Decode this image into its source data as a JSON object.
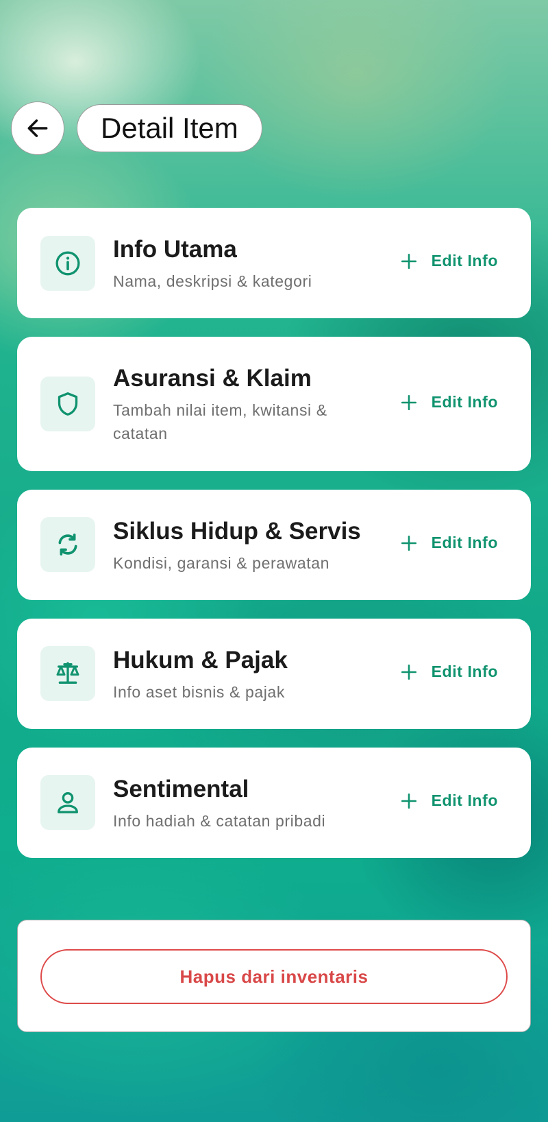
{
  "header": {
    "title": "Detail Item",
    "back_icon": "arrow-left-icon"
  },
  "accent_color": "#10936f",
  "danger_color": "#d94848",
  "sections": [
    {
      "icon": "info-icon",
      "title": "Info Utama",
      "subtitle": "Nama, deskripsi & kategori",
      "action_label": "Edit Info"
    },
    {
      "icon": "shield-icon",
      "title": "Asuransi & Klaim",
      "subtitle": "Tambah nilai item, kwitansi & catatan",
      "action_label": "Edit Info"
    },
    {
      "icon": "refresh-icon",
      "title": "Siklus Hidup & Servis",
      "subtitle": "Kondisi, garansi & perawatan",
      "action_label": "Edit Info"
    },
    {
      "icon": "scale-icon",
      "title": "Hukum & Pajak",
      "subtitle": "Info aset bisnis & pajak",
      "action_label": "Edit Info"
    },
    {
      "icon": "person-icon",
      "title": "Sentimental",
      "subtitle": "Info hadiah & catatan pribadi",
      "action_label": "Edit Info"
    }
  ],
  "danger_zone": {
    "delete_label": "Hapus dari inventaris"
  }
}
